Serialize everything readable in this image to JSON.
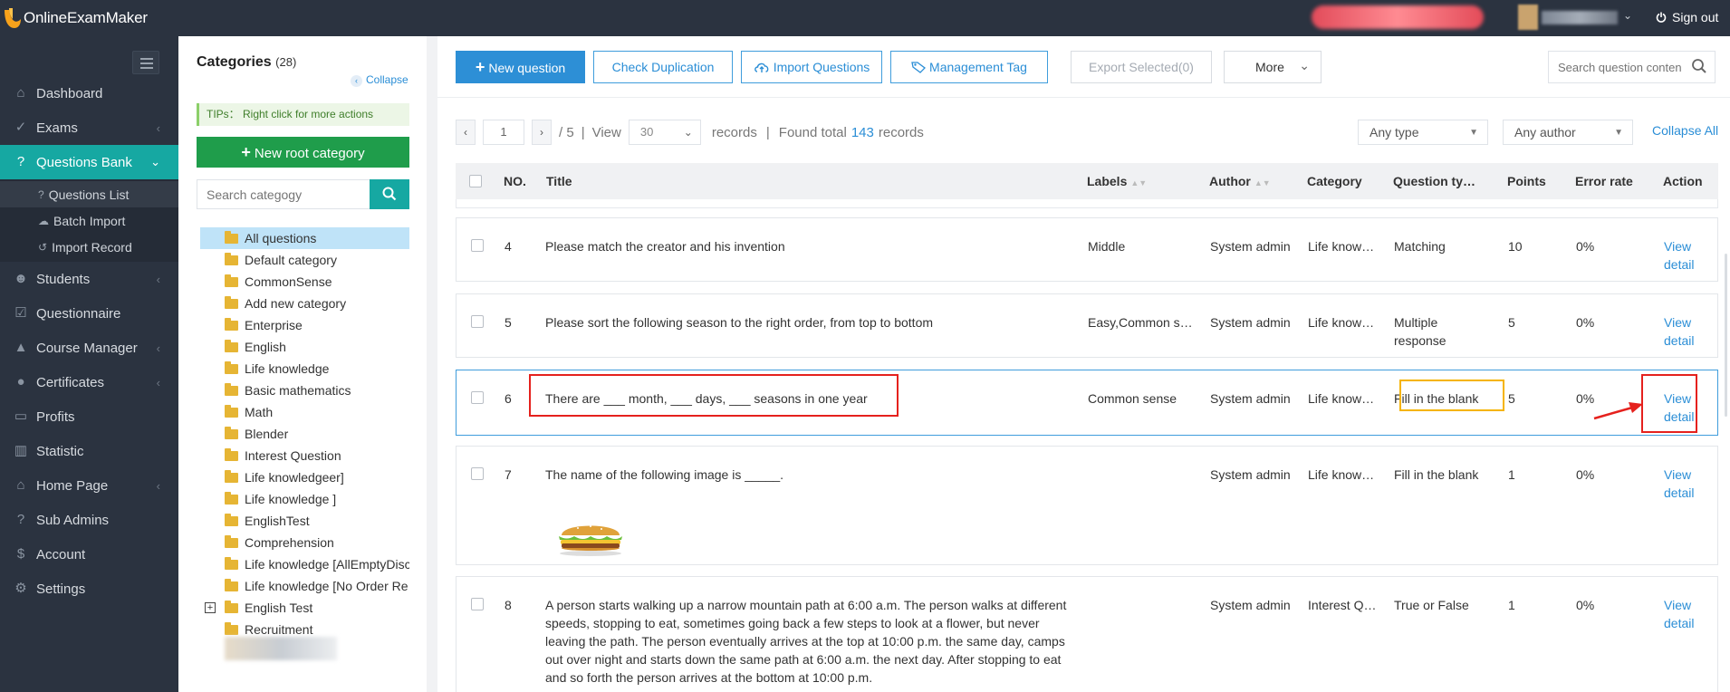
{
  "app": {
    "name": "OnlineExamMaker",
    "sign_out": "Sign out"
  },
  "sidebar": {
    "items": [
      {
        "label": "Dashboard",
        "icon": "home-icon",
        "glyph": "⌂",
        "chev": ""
      },
      {
        "label": "Exams",
        "icon": "check-circle-icon",
        "glyph": "✓",
        "chev": "‹"
      },
      {
        "label": "Questions Bank",
        "icon": "question-circle-icon",
        "glyph": "?",
        "chev": "⌄"
      },
      {
        "label": "Students",
        "icon": "users-icon",
        "glyph": "☻",
        "chev": "‹"
      },
      {
        "label": "Questionnaire",
        "icon": "checkbox-icon",
        "glyph": "☑",
        "chev": ""
      },
      {
        "label": "Course Manager",
        "icon": "graduation-cap-icon",
        "glyph": "▲",
        "chev": "‹"
      },
      {
        "label": "Certificates",
        "icon": "certificate-icon",
        "glyph": "●",
        "chev": "‹"
      },
      {
        "label": "Profits",
        "icon": "credit-card-icon",
        "glyph": "▭",
        "chev": ""
      },
      {
        "label": "Statistic",
        "icon": "bar-chart-icon",
        "glyph": "▥",
        "chev": ""
      },
      {
        "label": "Home Page",
        "icon": "bank-icon",
        "glyph": "⌂",
        "chev": "‹"
      },
      {
        "label": "Sub Admins",
        "icon": "question-circle-icon",
        "glyph": "?",
        "chev": ""
      },
      {
        "label": "Account",
        "icon": "dollar-icon",
        "glyph": "$",
        "chev": ""
      },
      {
        "label": "Settings",
        "icon": "gear-icon",
        "glyph": "⚙",
        "chev": ""
      }
    ],
    "subitems": [
      {
        "label": "Questions List",
        "glyph": "?"
      },
      {
        "label": "Batch Import",
        "glyph": "☁"
      },
      {
        "label": "Import Record",
        "glyph": "↺"
      }
    ]
  },
  "categories": {
    "title": "Categories",
    "count": "(28)",
    "collapse": "Collapse",
    "tips": "TIPs： Right click for more actions",
    "new_root": "New root category",
    "search_placeholder": "Search categogy",
    "tree": [
      "All questions",
      "Default category",
      "CommonSense",
      "Add new category",
      "Enterprise",
      "English",
      "Life knowledge",
      "Basic mathematics",
      "Math",
      "Blender",
      "Interest Question",
      "Life knowledgeer]",
      "Life knowledge ]",
      "EnglishTest",
      "Comprehension",
      "Life knowledge [AllEmptyDisc",
      "Life knowledge [No Order Re",
      "English Test",
      "Recruitment"
    ]
  },
  "toolbar": {
    "new_question": "New question",
    "check_duplication": "Check Duplication",
    "import_questions": "Import Questions",
    "management_tag": "Management Tag",
    "export_selected": "Export Selected(0)",
    "more": "More",
    "search_placeholder": "Search question content"
  },
  "pager": {
    "page": "1",
    "total_pages": "/ 5",
    "view": "View",
    "per_page": "30",
    "records": "records",
    "found": "Found total",
    "found_count": "143",
    "found_suffix": "records",
    "type_filter": "Any type",
    "author_filter": "Any author",
    "collapse_all": "Collapse All"
  },
  "table": {
    "headers": {
      "no": "NO.",
      "title": "Title",
      "labels": "Labels",
      "author": "Author",
      "category": "Category",
      "question_type": "Question type",
      "points": "Points",
      "error_rate": "Error rate",
      "action": "Action"
    },
    "rows": [
      {
        "no": "4",
        "title": "Please match the creator and his invention",
        "labels": "Middle",
        "author": "System admin",
        "category": "Life knowledge",
        "type": "Matching",
        "points": "10",
        "error": "0%",
        "action1": "View",
        "action2": "detail"
      },
      {
        "no": "5",
        "title": "Please sort the following season to the right order, from top to bottom",
        "labels": "Easy,Common sense",
        "author": "System admin",
        "category": "Life knowledge",
        "type": "Multiple response",
        "points": "5",
        "error": "0%",
        "action1": "View",
        "action2": "detail"
      },
      {
        "no": "6",
        "title": "There are ___ month, ___ days, ___ seasons in one year",
        "labels": "Common sense",
        "author": "System admin",
        "category": "Life knowledge",
        "type": "Fill in the blank",
        "points": "5",
        "error": "0%",
        "action1": "View",
        "action2": "detail"
      },
      {
        "no": "7",
        "title": "The name of the following image is _____.",
        "labels": "",
        "author": "System admin",
        "category": "Life knowledge",
        "type": "Fill in the blank",
        "points": "1",
        "error": "0%",
        "action1": "View",
        "action2": "detail"
      },
      {
        "no": "8",
        "title": "A person starts walking up a narrow mountain path at 6:00 a.m. The person walks at different speeds, stopping to eat, sometimes going back a few steps to look at a flower, but never leaving the path. The person eventually arrives at the top at 10:00 p.m. the same day, camps out over night and starts down the same path at 6:00 a.m. the next day. After stopping to eat and so forth the person arrives at the bottom at 10:00 p.m.",
        "labels": "",
        "author": "System admin",
        "category": "Interest Question",
        "type": "True or False",
        "points": "1",
        "error": "0%",
        "action1": "View",
        "action2": "detail"
      }
    ]
  },
  "colors": {
    "accent": "#16a8a2",
    "primary": "#2d8fd6",
    "annotation_red": "#e5211d",
    "annotation_yellow": "#f5b400"
  }
}
